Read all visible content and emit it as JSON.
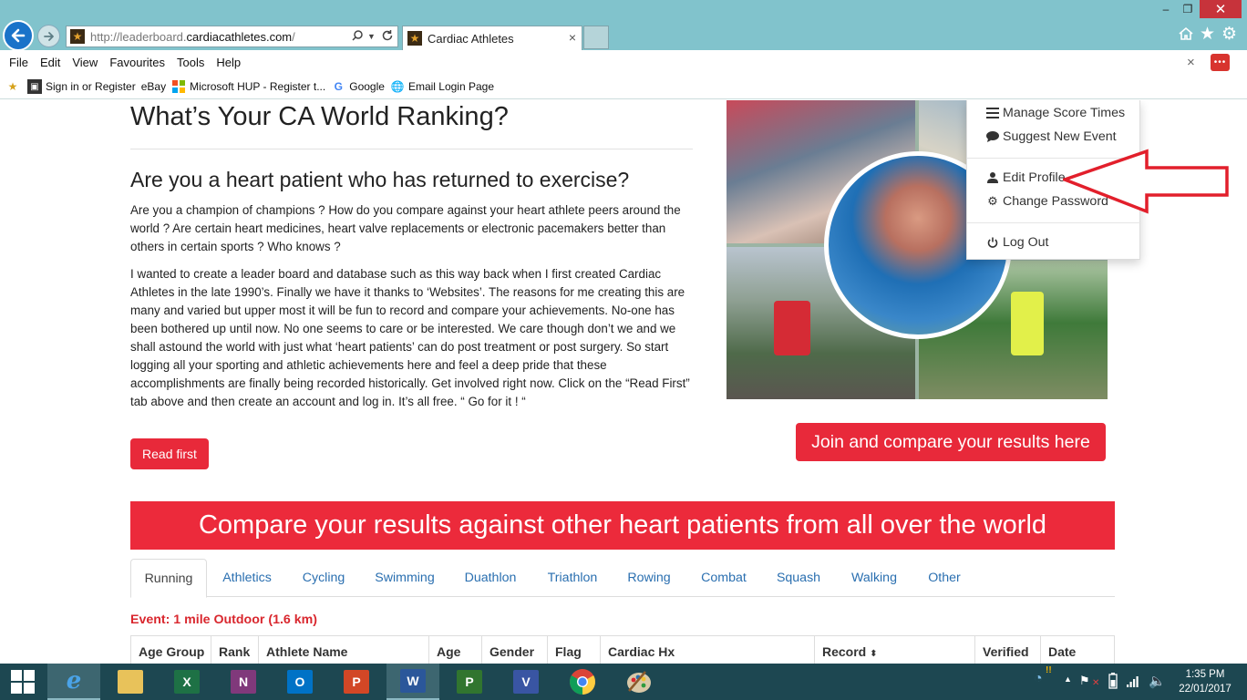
{
  "browser": {
    "url_prefix": "http://leaderboard.",
    "url_domain": "cardiacathletes.com",
    "url_suffix": "/",
    "tab_title": "Cardiac Athletes",
    "tab_close": "×",
    "window": {
      "minimize": "–",
      "maximize": "❐",
      "close": "✕"
    },
    "menu": [
      "File",
      "Edit",
      "View",
      "Favourites",
      "Tools",
      "Help"
    ],
    "menubar_close": "×",
    "favourites": [
      {
        "label": "Sign in or Register",
        "icon": "shopping-bag-icon"
      },
      {
        "label": "eBay",
        "icon": "none"
      },
      {
        "label": "Microsoft HUP - Register t...",
        "icon": "microsoft-logo-icon"
      },
      {
        "label": "Google",
        "icon": "google-icon"
      },
      {
        "label": "Email Login Page",
        "icon": "globe-icon"
      }
    ]
  },
  "page": {
    "title": "What’s Your CA World Ranking?",
    "subheading": "Are you a heart patient who has returned to exercise?",
    "para1": "Are you a champion of champions ? How do you compare against your heart athlete peers around the world ? Are certain heart medicines, heart valve replacements or electronic pacemakers better than others in certain sports ? Who knows ?",
    "para2": "I wanted to create a leader board and database such as this way back when I first created Cardiac Athletes in the late 1990’s. Finally we have it thanks to ‘Websites’. The reasons for me creating this are many and varied but upper most it will be fun to record and compare your achievements. No-one has been bothered up until now. No one seems to care or be interested. We care though don’t we and we shall astound the world with just what ‘heart patients’ can do post treatment or post surgery. So start logging all your sporting and athletic achievements here and feel a deep pride that these accomplishments are finally being recorded historically. Get involved right now. Click on the “Read First” tab above and then create an account and log in. It’s all free. “ Go for it ! “",
    "read_first": "Read first",
    "join_button": "Join and compare your results here",
    "banner": "Compare your results against other heart patients from all over the world",
    "sport_tabs": [
      "Running",
      "Athletics",
      "Cycling",
      "Swimming",
      "Duathlon",
      "Triathlon",
      "Rowing",
      "Combat",
      "Squash",
      "Walking",
      "Other"
    ],
    "active_tab": "Running",
    "event_title": "Event: 1 mile Outdoor (1.6 km)",
    "table_headers": [
      "Age Group",
      "Rank",
      "Athlete Name",
      "Age",
      "Gender",
      "Flag",
      "Cardiac Hx",
      "Record",
      "Verified",
      "Date"
    ]
  },
  "dropdown": {
    "items": [
      {
        "label": "Manage Score Times",
        "icon": "list-icon"
      },
      {
        "label": "Suggest New Event",
        "icon": "comment-icon"
      },
      {
        "label": "Edit Profile",
        "icon": "user-icon"
      },
      {
        "label": "Change Password",
        "icon": "gear-icon"
      },
      {
        "label": "Log Out",
        "icon": "power-icon"
      }
    ]
  },
  "taskbar": {
    "apps": [
      "Internet Explorer",
      "File Explorer",
      "Excel",
      "OneNote",
      "Outlook",
      "PowerPoint",
      "Word",
      "Project",
      "Visio",
      "Chrome",
      "Paint"
    ],
    "time": "1:35 PM",
    "date": "22/01/2017"
  },
  "colors": {
    "accent_red": "#e8293a",
    "link_blue": "#2a6fb0",
    "titlebar": "#81c3cc",
    "taskbar": "#1d4751"
  }
}
